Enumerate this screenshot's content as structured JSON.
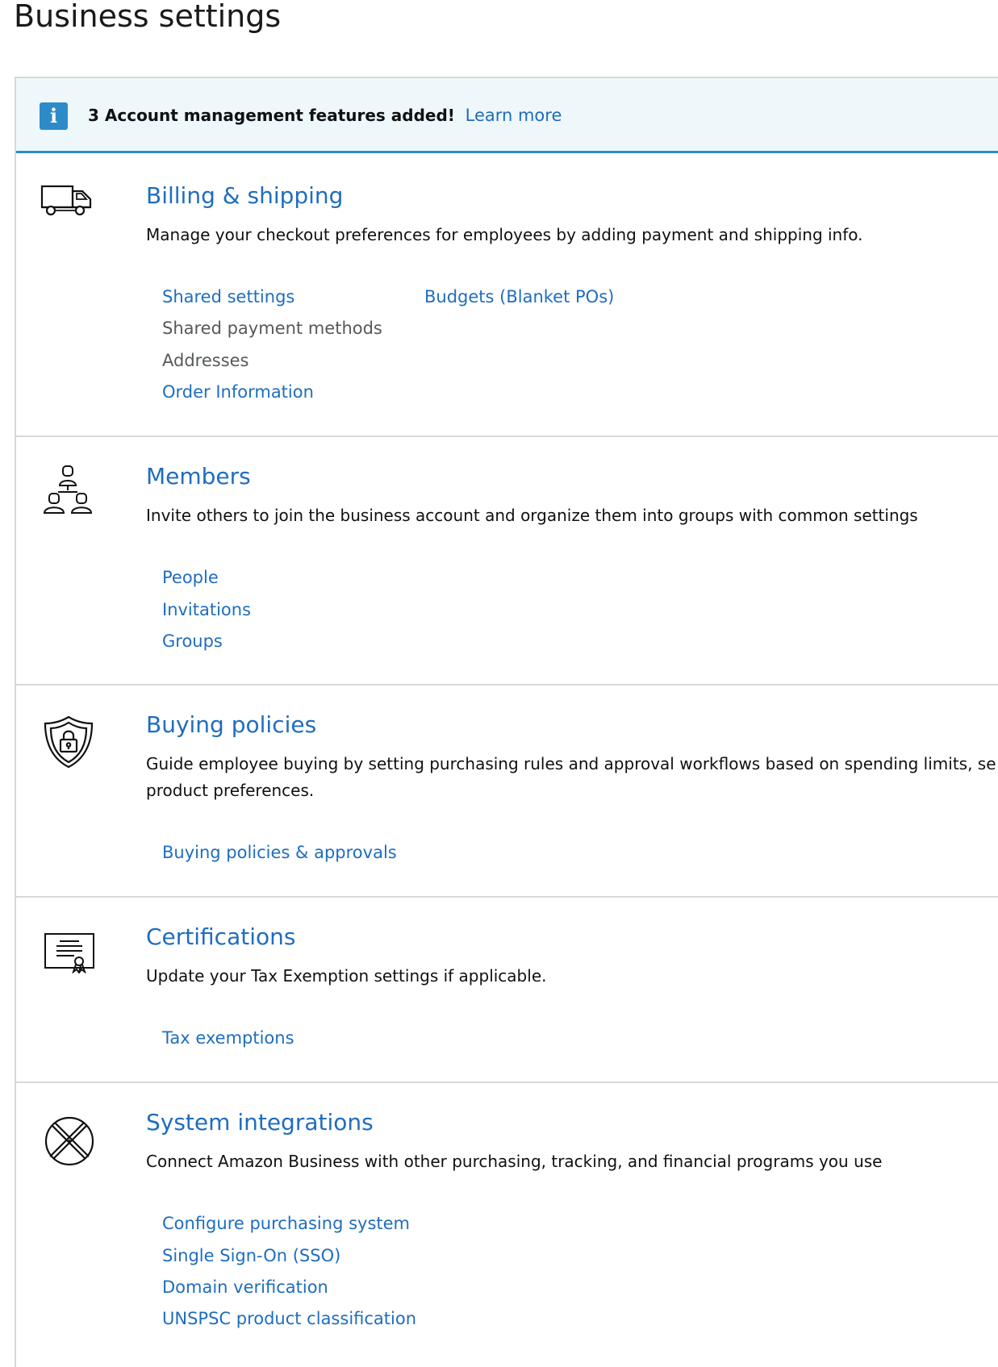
{
  "page": {
    "title": "Business settings"
  },
  "alert": {
    "icon": "info-icon",
    "icon_glyph": "i",
    "message": "3 Account management features added!",
    "link": "Learn more",
    "accent": "#2e8bc9",
    "background": "#eef7fa"
  },
  "colors": {
    "link": "#1f6dbf",
    "muted_text": "#565959",
    "divider": "#d5d9d9"
  },
  "sections": [
    {
      "icon": "truck-icon",
      "title": "Billing & shipping",
      "description": "Manage your checkout preferences for employees by adding payment and shipping info.",
      "col1": [
        {
          "label": "Shared settings",
          "link": true
        },
        {
          "label": "Shared payment methods",
          "link": false
        },
        {
          "label": "Addresses",
          "link": false
        },
        {
          "label": "Order Information",
          "link": true
        }
      ],
      "col2": [
        {
          "label": "Budgets (Blanket POs)",
          "link": true
        }
      ]
    },
    {
      "icon": "people-hierarchy-icon",
      "title": "Members",
      "description": "Invite others to join the business account and organize them into groups with common settings",
      "col1": [
        {
          "label": "People",
          "link": true
        },
        {
          "label": "Invitations",
          "link": true
        },
        {
          "label": "Groups",
          "link": true
        }
      ]
    },
    {
      "icon": "shield-lock-icon",
      "title": "Buying policies",
      "description": "Guide employee buying by setting purchasing rules and approval workflows based on spending limits, se product preferences.",
      "col1": [
        {
          "label": "Buying policies & approvals",
          "link": true
        }
      ]
    },
    {
      "icon": "certificate-icon",
      "title": "Certifications",
      "description": "Update your Tax Exemption settings if applicable.",
      "col1": [
        {
          "label": "Tax exemptions",
          "link": true
        }
      ]
    },
    {
      "icon": "integration-icon",
      "title": "System integrations",
      "description": "Connect Amazon Business with other purchasing, tracking, and financial programs you use",
      "col1": [
        {
          "label": "Configure purchasing system",
          "link": true
        },
        {
          "label": "Single Sign-On (SSO)",
          "link": true
        },
        {
          "label": "Domain verification",
          "link": true
        },
        {
          "label": "UNSPSC product classification",
          "link": true
        }
      ]
    }
  ]
}
